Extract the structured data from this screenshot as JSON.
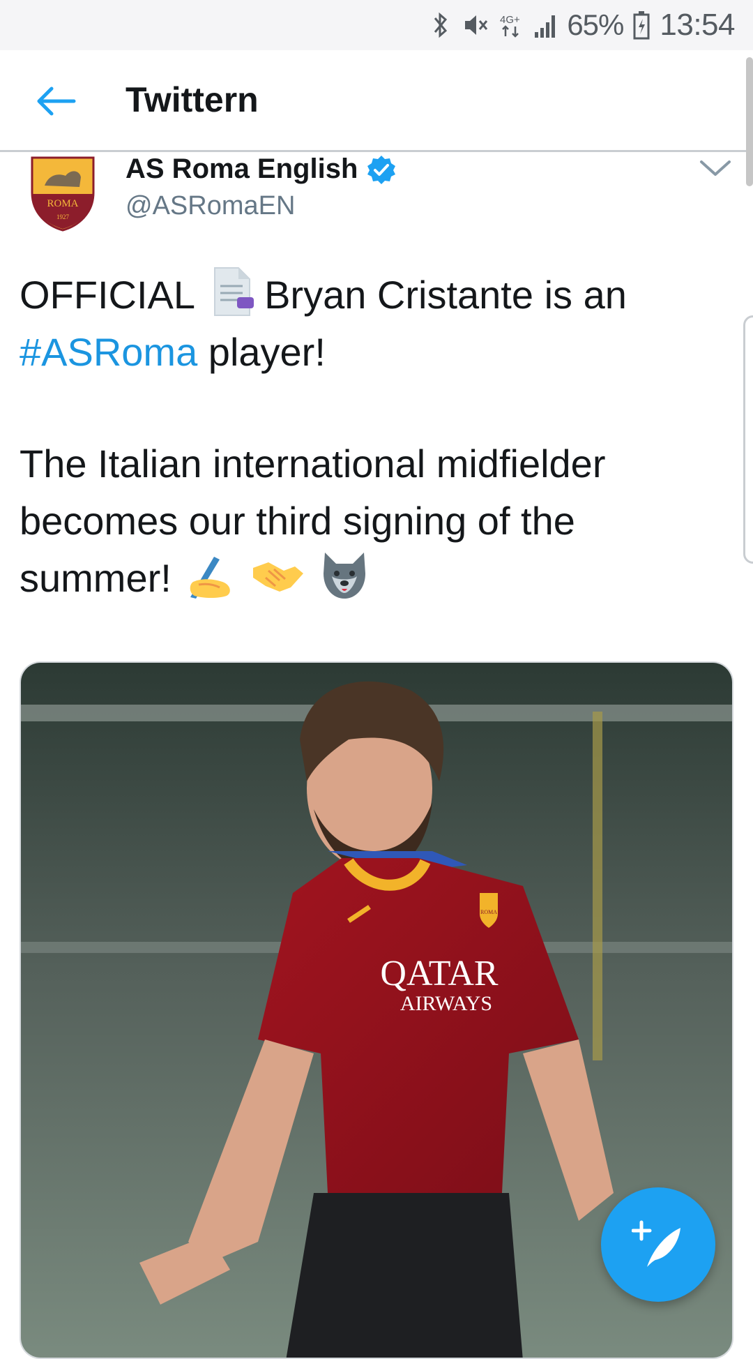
{
  "status_bar": {
    "network": "4G+",
    "battery": "65%",
    "time": "13:54",
    "icons": [
      "bluetooth-icon",
      "mute-icon",
      "network-4g-icon",
      "signal-icon",
      "battery-icon"
    ]
  },
  "app_bar": {
    "title": "Twittern",
    "back_icon": "arrow-left-icon"
  },
  "tweet": {
    "author": {
      "name": "AS Roma English",
      "handle": "@ASRomaEN",
      "verified": true,
      "avatar_text": "ROMA",
      "avatar_year": "1927"
    },
    "text": {
      "line1_prefix": "OFFICIAL",
      "line1_suffix": "Bryan Cristante is an",
      "hashtag": "#ASRoma",
      "line2_suffix": "player!",
      "para2": "The Italian international midfielder becomes our third signing of the summer!",
      "emojis": [
        "page-facing-up",
        "writing-hand",
        "handshake",
        "wolf"
      ]
    },
    "media": {
      "shirt_sponsor_line1": "QATAR",
      "shirt_sponsor_line2": "AIRWAYS",
      "crest_text": "ROMA"
    }
  },
  "fab": {
    "icon": "compose-tweet-icon"
  },
  "colors": {
    "accent": "#1da1f2",
    "link": "#1b95e0",
    "text": "#14171a",
    "secondary": "#657786"
  }
}
